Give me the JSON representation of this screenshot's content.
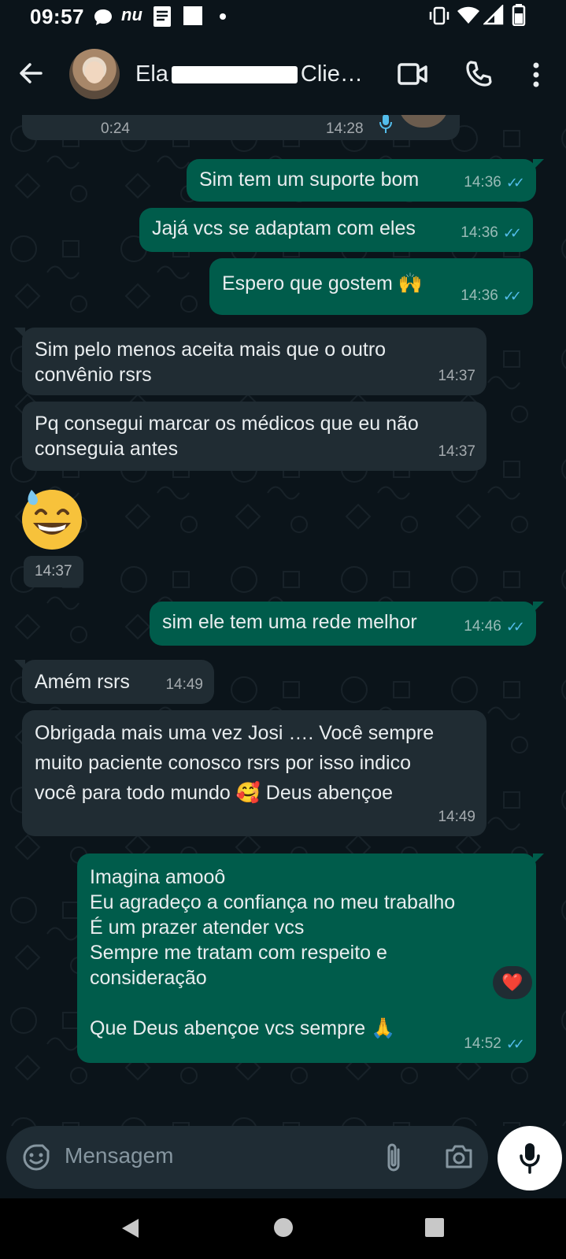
{
  "status_bar": {
    "time": "09:57",
    "icons": [
      "chat-bubble-icon",
      "nu-icon",
      "document-icon",
      "square-icon",
      "dot-icon",
      "vibrate-icon",
      "wifi-icon",
      "signal-icon",
      "battery-icon"
    ],
    "nu_label": "nu"
  },
  "header": {
    "name_start": "Ela",
    "name_end": "Clie…",
    "icons": [
      "back-arrow-icon",
      "video-call-icon",
      "phone-icon",
      "more-vert-icon"
    ]
  },
  "messages": [
    {
      "dir": "in",
      "partial": true,
      "duration": "0:24",
      "time": "14:28"
    },
    {
      "dir": "out",
      "text": "Sim tem um suporte bom",
      "time": "14:36",
      "status": "read"
    },
    {
      "dir": "out",
      "text": "Jajá vcs se adaptam com eles",
      "time": "14:36",
      "status": "read"
    },
    {
      "dir": "out",
      "text": "Espero que gostem 🙌",
      "time": "14:36",
      "status": "read"
    },
    {
      "dir": "in",
      "text": "Sim pelo menos aceita mais que o outro\nconvênio rsrs",
      "time": "14:37"
    },
    {
      "dir": "in",
      "text": "Pq consegui marcar os médicos que eu não\nconseguia antes",
      "time": "14:37"
    },
    {
      "dir": "in",
      "emoji": "😅",
      "time": "14:37"
    },
    {
      "dir": "out",
      "text": "sim ele tem uma rede melhor",
      "time": "14:46",
      "status": "read"
    },
    {
      "dir": "in",
      "text": "Amém rsrs",
      "time": "14:49"
    },
    {
      "dir": "in",
      "text": "Obrigada mais uma vez Josi …. Você sempre\nmuito paciente conosco rsrs por isso indico\nvocê para todo mundo 🥰 Deus abençoe",
      "time": "14:49"
    },
    {
      "dir": "out",
      "text": "Imagina amooô\nEu agradeço a confiança no meu trabalho\nÉ um prazer atender vcs\nSempre me tratam com respeito e\nconsideração\n\nQue Deus abençoe vcs sempre 🙏",
      "time": "14:52",
      "status": "read",
      "reaction": "❤️"
    }
  ],
  "input": {
    "placeholder": "Mensagem",
    "icons": [
      "emoji-icon",
      "attach-icon",
      "camera-icon",
      "mic-icon"
    ]
  },
  "nav": {
    "icons": [
      "nav-back-icon",
      "nav-home-icon",
      "nav-recents-icon"
    ]
  },
  "colors": {
    "background": "#0b141a",
    "outgoing": "#005c4b",
    "incoming": "#202c33",
    "read_ticks": "#53bdeb"
  }
}
